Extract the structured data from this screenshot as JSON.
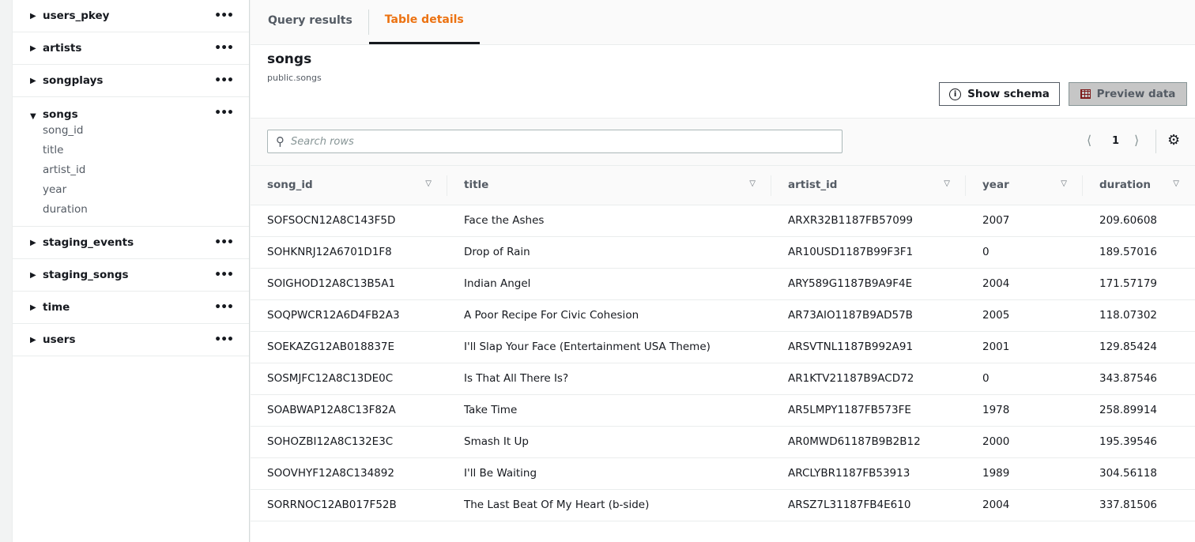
{
  "sidebar": {
    "tables": [
      {
        "name": "users_pkey",
        "expanded": false
      },
      {
        "name": "artists",
        "expanded": false
      },
      {
        "name": "songplays",
        "expanded": false
      },
      {
        "name": "songs",
        "expanded": true,
        "columns": [
          "song_id",
          "title",
          "artist_id",
          "year",
          "duration"
        ]
      },
      {
        "name": "staging_events",
        "expanded": false
      },
      {
        "name": "staging_songs",
        "expanded": false
      },
      {
        "name": "time",
        "expanded": false
      },
      {
        "name": "users",
        "expanded": false
      }
    ]
  },
  "tabs": {
    "query_results": "Query results",
    "table_details": "Table details",
    "active": "Table details"
  },
  "header": {
    "title": "songs",
    "subtitle": "public.songs",
    "show_schema": "Show schema",
    "preview_data": "Preview data"
  },
  "toolbar": {
    "search_placeholder": "Search rows",
    "page": "1"
  },
  "table": {
    "columns": [
      "song_id",
      "title",
      "artist_id",
      "year",
      "duration"
    ],
    "rows": [
      [
        "SOFSOCN12A8C143F5D",
        "Face the Ashes",
        "ARXR32B1187FB57099",
        "2007",
        "209.60608"
      ],
      [
        "SOHKNRJ12A6701D1F8",
        "Drop of Rain",
        "AR10USD1187B99F3F1",
        "0",
        "189.57016"
      ],
      [
        "SOIGHOD12A8C13B5A1",
        "Indian Angel",
        "ARY589G1187B9A9F4E",
        "2004",
        "171.57179"
      ],
      [
        "SOQPWCR12A6D4FB2A3",
        "A Poor Recipe For Civic Cohesion",
        "AR73AIO1187B9AD57B",
        "2005",
        "118.07302"
      ],
      [
        "SOEKAZG12AB018837E",
        "I'll Slap Your Face (Entertainment USA Theme)",
        "ARSVTNL1187B992A91",
        "2001",
        "129.85424"
      ],
      [
        "SOSMJFC12A8C13DE0C",
        "Is That All There Is?",
        "AR1KTV21187B9ACD72",
        "0",
        "343.87546"
      ],
      [
        "SOABWAP12A8C13F82A",
        "Take Time",
        "AR5LMPY1187FB573FE",
        "1978",
        "258.89914"
      ],
      [
        "SOHOZBI12A8C132E3C",
        "Smash It Up",
        "AR0MWD61187B9B2B12",
        "2000",
        "195.39546"
      ],
      [
        "SOOVHYF12A8C134892",
        "I'll Be Waiting",
        "ARCLYBR1187FB53913",
        "1989",
        "304.56118"
      ],
      [
        "SORRNOC12AB017F52B",
        "The Last Beat Of My Heart (b-side)",
        "ARSZ7L31187FB4E610",
        "2004",
        "337.81506"
      ]
    ]
  },
  "colors": {
    "accent": "#ec7211"
  }
}
